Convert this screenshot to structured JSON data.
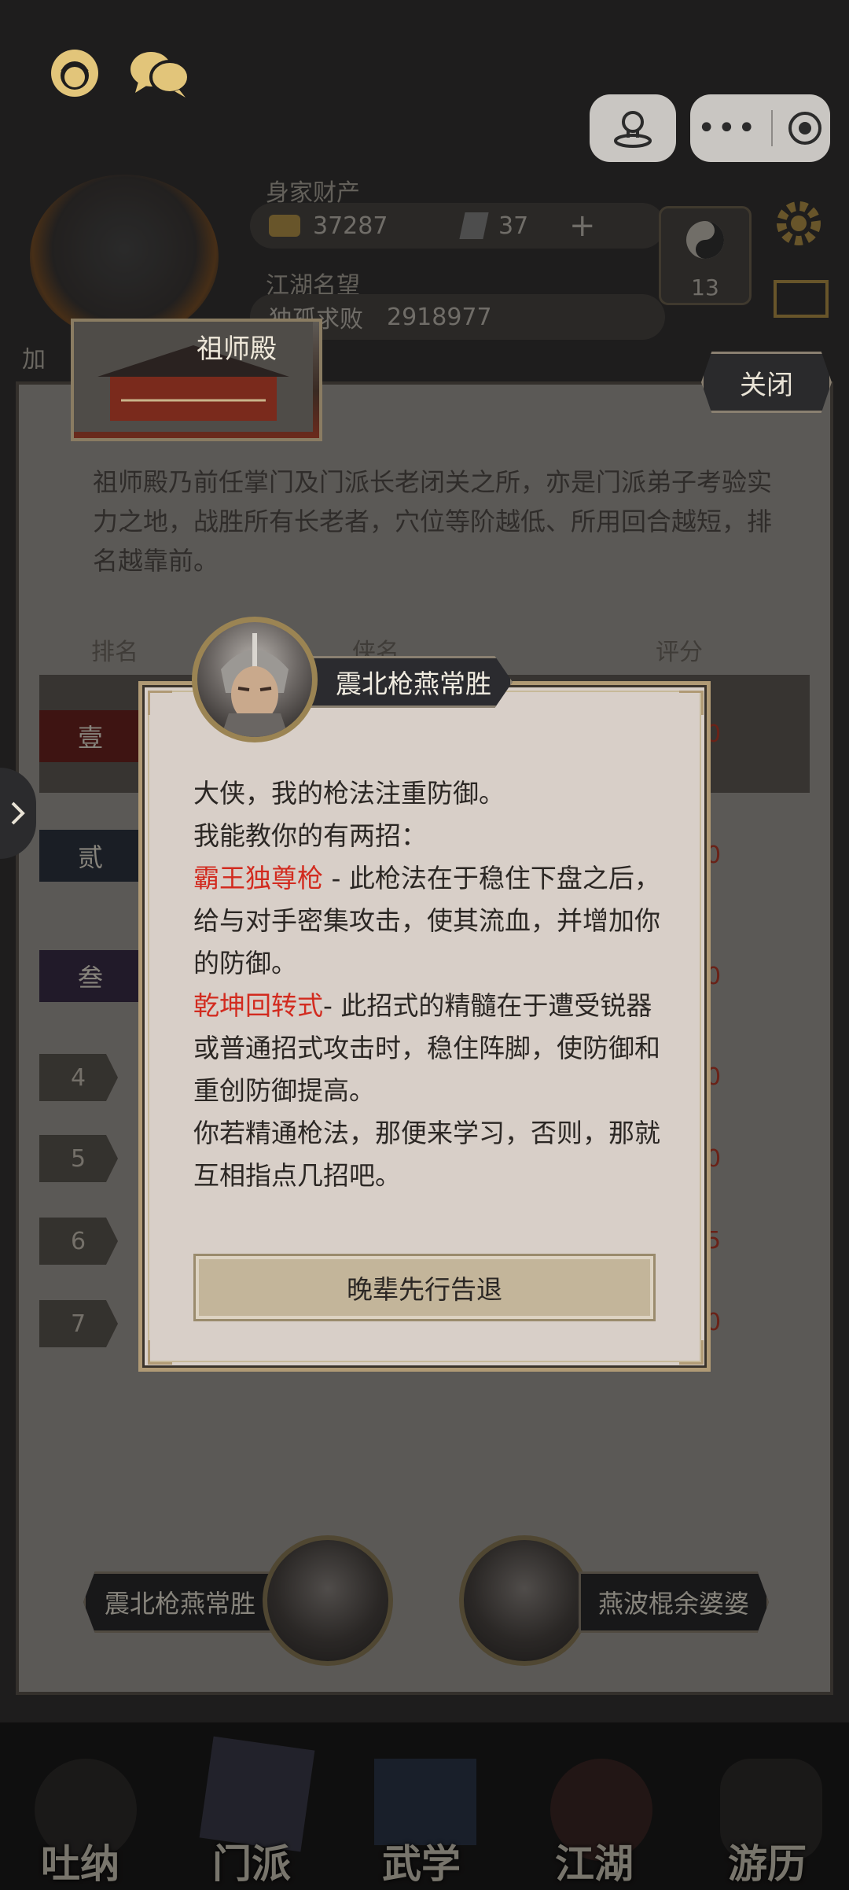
{
  "hud": {
    "assets_label": "身家财产",
    "coins": "37287",
    "gems": "37",
    "plus": "+",
    "fame_label": "江湖名望",
    "title": "独孤求败",
    "fame_value": "2918977",
    "level": "13",
    "side_tag": "加"
  },
  "panel": {
    "hall_name": "祖师殿",
    "close_label": "关闭",
    "description": "祖师殿乃前任掌门及门派长老闭关之所，亦是门派弟子考验实力之地，战胜所有长老者，穴位等阶越低、所用回合越短，排名越靠前。",
    "col_rank": "排名",
    "col_name": "侠名",
    "col_score": "评分",
    "ranks": [
      "壹",
      "贰",
      "叁",
      "4",
      "5",
      "6",
      "7"
    ],
    "score_fragments": [
      "0",
      "0",
      "0",
      "0",
      "0",
      "5",
      "0"
    ]
  },
  "dialog": {
    "npc_name": "震北枪燕常胜",
    "line1": "大侠，我的枪法注重防御。",
    "line2": "我能教你的有两招：",
    "skill1_name": "霸王独尊枪",
    "skill1_desc": " - 此枪法在于稳住下盘之后，给与对手密集攻击，使其流血，并增加你的防御。",
    "skill2_name": "乾坤回转式",
    "skill2_desc": "- 此招式的精髓在于遭受锐器或普通招式攻击时，稳住阵脚，使防御和重创防御提高。",
    "line_end": "你若精通枪法，那便来学习，否则，那就互相指点几招吧。",
    "exit_button": "晚辈先行告退"
  },
  "duel": {
    "left_name": "震北枪燕常胜",
    "right_name": "燕波棍余婆婆"
  },
  "nav": {
    "items": [
      "吐纳",
      "门派",
      "武学",
      "江湖",
      "游历"
    ]
  },
  "colors": {
    "accent_gold": "#b09a75",
    "skill_red": "#d22b1f",
    "dialog_bg": "#d8cfc8"
  }
}
